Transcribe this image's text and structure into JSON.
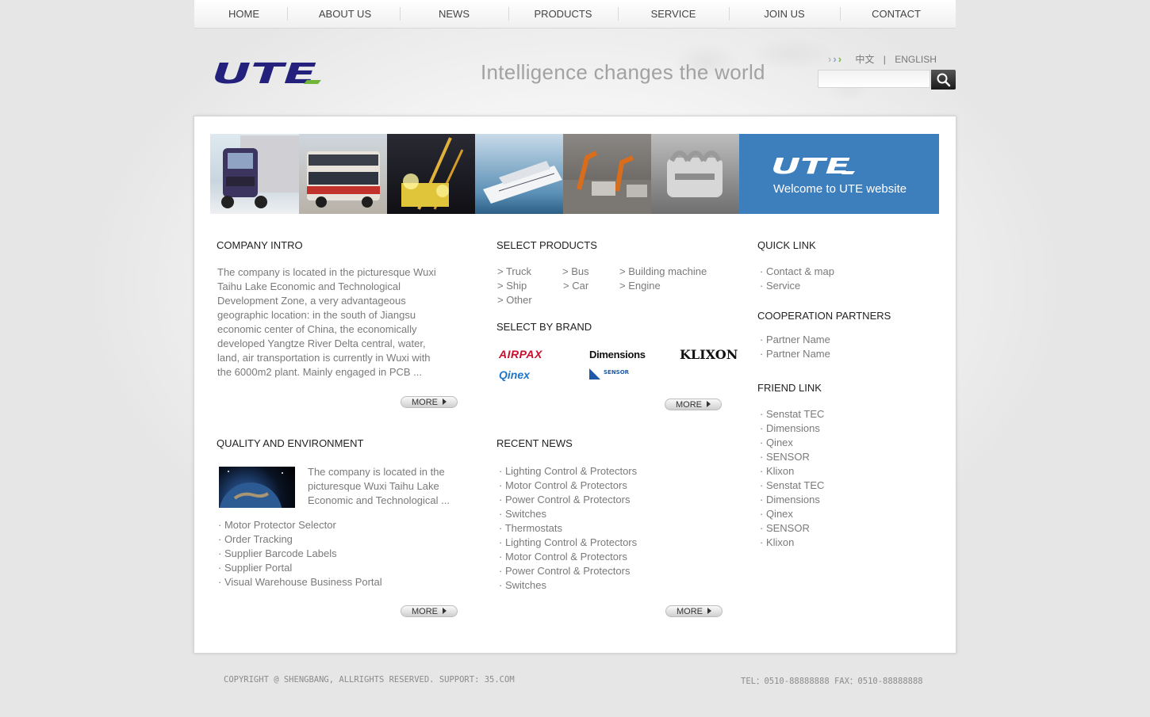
{
  "nav": [
    "HOME",
    "ABOUT US",
    "NEWS",
    "PRODUCTS",
    "SERVICE",
    "JOIN US",
    "CONTACT"
  ],
  "header": {
    "logo_text": "UTE",
    "slogan": "Intelligence changes the world",
    "lang_cn": "中文",
    "lang_sep": "|",
    "lang_en": "ENGLISH",
    "search_placeholder": ""
  },
  "banner": {
    "welcome_logo": "UTE",
    "welcome_text": "Welcome to UTE website",
    "tiles": [
      "truck",
      "bus",
      "crane",
      "ship",
      "factory",
      "engine"
    ]
  },
  "company_intro": {
    "title": "COMPANY INTRO",
    "lines": [
      "The company is located in the picturesque Wuxi",
      "Taihu Lake Economic and Technological",
      "Development Zone, a very advantageous",
      "geographic location: in the south of Jiangsu",
      "economic center of China, the economically",
      "developed Yangtze River Delta central, water,",
      "land, air transportation is currently in Wuxi with",
      "the 6000m2 plant. Mainly engaged in PCB  ..."
    ],
    "more": "MORE"
  },
  "select_products": {
    "title": "SELECT PRODUCTS",
    "items": [
      "> Truck",
      "> Bus",
      "> Building machine",
      "> Ship",
      "> Car",
      "> Engine",
      "> Other"
    ]
  },
  "select_brand": {
    "title": "SELECT BY BRAND",
    "brands": [
      "AIRPAX",
      "Dimensions",
      "KLIXON",
      "Qinex",
      "SENSOR NITE"
    ],
    "more": "MORE"
  },
  "quick_link": {
    "title": "QUICK LINK",
    "items": [
      "· Contact & map",
      "· Service"
    ]
  },
  "partners": {
    "title": "COOPERATION PARTNERS",
    "items": [
      "· Partner Name",
      "· Partner Name"
    ]
  },
  "friend_link": {
    "title": "FRIEND LINK",
    "items": [
      "· Senstat TEC",
      "· Dimensions",
      "· Qinex",
      "· SENSOR",
      "· Klixon",
      "· Senstat TEC",
      "· Dimensions",
      "· Qinex",
      "· SENSOR",
      "· Klixon"
    ]
  },
  "quality": {
    "title": "QUALITY AND ENVIRONMENT",
    "lines": [
      "The company is located in the",
      "picturesque Wuxi Taihu Lake",
      "Economic and Technological ..."
    ],
    "links": [
      "· Motor Protector Selector",
      "· Order Tracking",
      "· Supplier Barcode Labels",
      "· Supplier Portal",
      "· Visual Warehouse Business Portal"
    ],
    "more": "MORE"
  },
  "recent_news": {
    "title": "RECENT NEWS",
    "items": [
      "· Lighting Control & Protectors",
      "· Motor Control & Protectors",
      "· Power Control & Protectors",
      "· Switches",
      "· Thermostats",
      "· Lighting Control & Protectors",
      "· Motor Control & Protectors",
      "· Power Control & Protectors",
      "· Switches"
    ],
    "more": "MORE"
  },
  "footer": {
    "copyright": "COPYRIGHT @ SHENGBANG, ALLRIGHTS RESERVED.  SUPPORT: 35.COM",
    "contact": "TEL：0510-88888888  FAX：0510-88888888"
  },
  "colors": {
    "logo_blue": "#23217b",
    "logo_green": "#6fb63b",
    "welcome_bg": "#3d7fbd",
    "airpax_red": "#c8102e"
  }
}
